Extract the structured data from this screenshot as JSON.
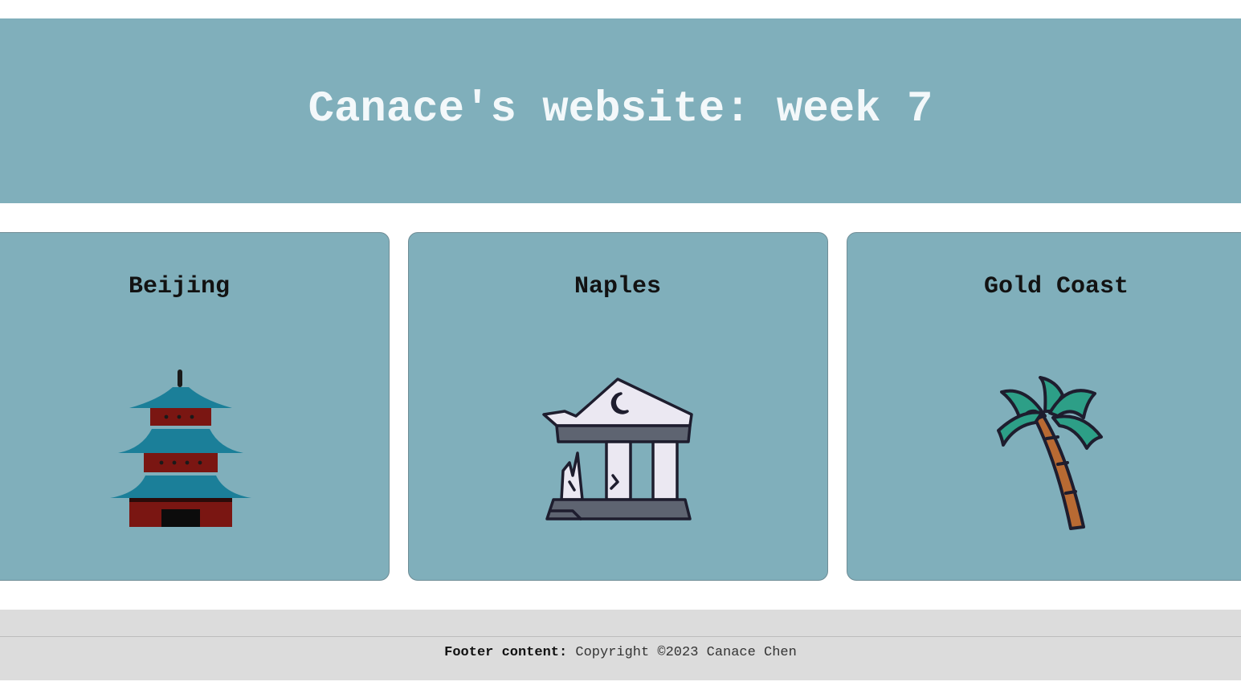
{
  "header": {
    "title": "Canace's website: week 7"
  },
  "cards": [
    {
      "title": "Beijing",
      "icon": "pagoda-icon"
    },
    {
      "title": "Naples",
      "icon": "ruined-temple-icon"
    },
    {
      "title": "Gold Coast",
      "icon": "palm-tree-icon"
    }
  ],
  "footer": {
    "label": "Footer content:",
    "text": "Copyright ©2023 Canace Chen"
  },
  "colors": {
    "header_bg": "#80afbb",
    "card_bg": "#80afbb",
    "title_text": "#f3f8fa",
    "footer_bg": "#dcdcdc"
  }
}
